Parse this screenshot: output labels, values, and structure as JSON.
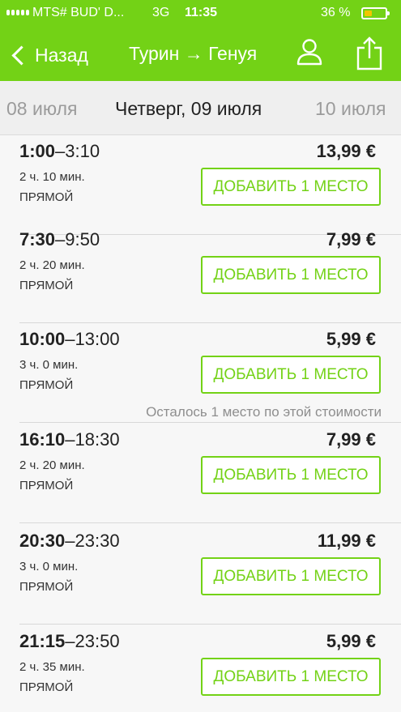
{
  "status_bar": {
    "carrier": "MTS# BUD' D...",
    "network": "3G",
    "time": "11:35",
    "battery": "36 %",
    "battery_level": 0.36
  },
  "nav": {
    "back_label": "Назад",
    "title": "Турин → Генуя"
  },
  "dates": {
    "prev": "08 июля",
    "current": "Четверг, 09 июля",
    "next": "10 июля"
  },
  "colors": {
    "accent": "#73d216",
    "text": "#222222",
    "muted": "#9b9b9b"
  },
  "trips": [
    {
      "dep": "1:00",
      "arr": "–3:10",
      "price": "13,99 €",
      "duration": "2 ч. 10 мин.",
      "type": "ПРЯМОЙ",
      "button": "ДОБАВИТЬ 1 МЕСТО",
      "note": ""
    },
    {
      "dep": "7:30",
      "arr": "–9:50",
      "price": "7,99 €",
      "duration": "2 ч. 20 мин.",
      "type": "ПРЯМОЙ",
      "button": "ДОБАВИТЬ 1 МЕСТО",
      "note": ""
    },
    {
      "dep": "10:00",
      "arr": "–13:00",
      "price": "5,99 €",
      "duration": "3 ч. 0 мин.",
      "type": "ПРЯМОЙ",
      "button": "ДОБАВИТЬ 1 МЕСТО",
      "note": "Осталось 1 место по этой стоимости"
    },
    {
      "dep": "16:10",
      "arr": "–18:30",
      "price": "7,99 €",
      "duration": "2 ч. 20 мин.",
      "type": "ПРЯМОЙ",
      "button": "ДОБАВИТЬ 1 МЕСТО",
      "note": ""
    },
    {
      "dep": "20:30",
      "arr": "–23:30",
      "price": "11,99 €",
      "duration": "3 ч. 0 мин.",
      "type": "ПРЯМОЙ",
      "button": "ДОБАВИТЬ 1 МЕСТО",
      "note": ""
    },
    {
      "dep": "21:15",
      "arr": "–23:50",
      "price": "5,99 €",
      "duration": "2 ч. 35 мин.",
      "type": "ПРЯМОЙ",
      "button": "ДОБАВИТЬ 1 МЕСТО",
      "note": ""
    }
  ]
}
